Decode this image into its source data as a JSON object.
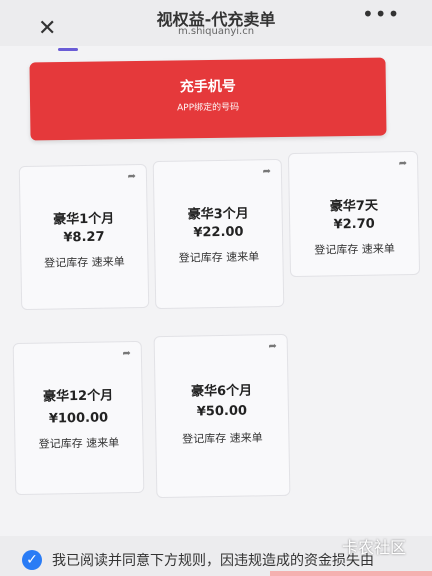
{
  "header": {
    "title": "视权益-代充卖单",
    "url": "m.shiquanyi.cn",
    "close_icon": "close-icon",
    "more_icon": "more-horizontal-icon",
    "close_glyph": "✕",
    "more_glyph": "•••"
  },
  "banner": {
    "title": "充手机号",
    "subtitle": "APP绑定的号码"
  },
  "products": [
    {
      "name": "豪华1个月",
      "price": "¥8.27",
      "tags": "登记库存  速来单",
      "share_glyph": "➦"
    },
    {
      "name": "豪华3个月",
      "price": "¥22.00",
      "tags": "登记库存  速来单",
      "share_glyph": "➦"
    },
    {
      "name": "豪华7天",
      "price": "¥2.70",
      "tags": "登记库存  速来单",
      "share_glyph": "➦"
    },
    {
      "name": "豪华12个月",
      "price": "¥100.00",
      "tags": "登记库存  速来单",
      "share_glyph": "➦"
    },
    {
      "name": "豪华6个月",
      "price": "¥50.00",
      "tags": "登记库存  速来单",
      "share_glyph": "➦"
    }
  ],
  "footer": {
    "agreement_text": "我已阅读并同意下方规则，因违规造成的资金损失由",
    "checked": true,
    "check_glyph": "✓"
  },
  "watermark": "卡农社区",
  "colors": {
    "banner": "#e5393b",
    "accent": "#6a5cd6",
    "checkbox": "#2a7cf5"
  }
}
